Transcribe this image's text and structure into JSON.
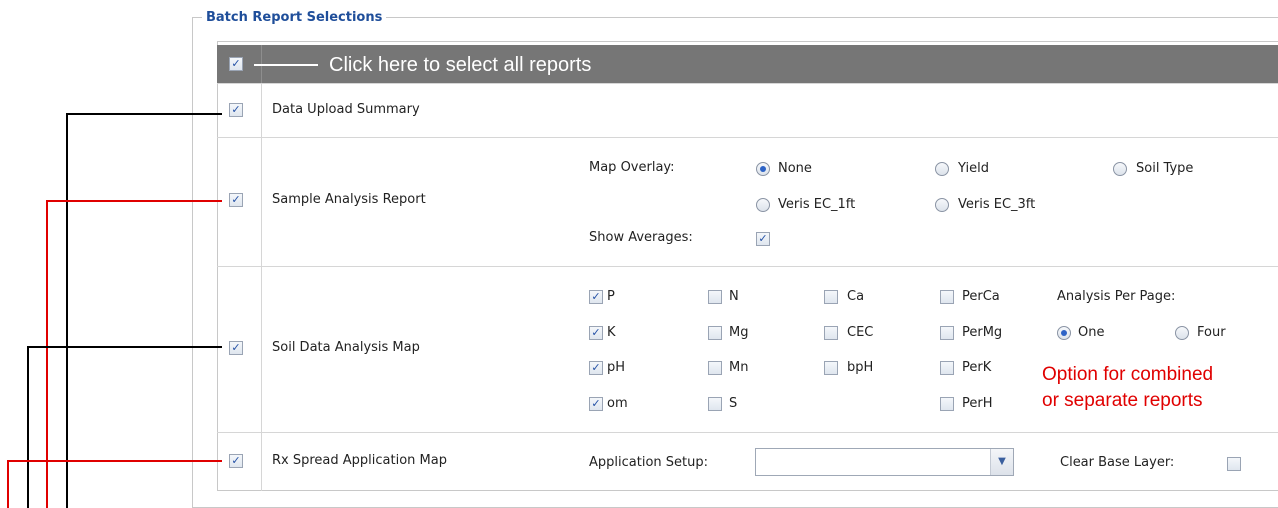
{
  "panel": {
    "title": "Batch Report Selections"
  },
  "header": {
    "select_all_label": "Click here to select all reports",
    "select_all_checked": true
  },
  "rows": {
    "upload": {
      "label": "Data Upload Summary",
      "checked": true
    },
    "sample": {
      "label": "Sample Analysis Report",
      "checked": true,
      "overlay_label": "Map Overlay:",
      "overlay_options": [
        "None",
        "Yield",
        "Soil Type",
        "Veris EC_1ft",
        "Veris EC_3ft"
      ],
      "overlay_selected": "None",
      "averages_label": "Show Averages:",
      "averages_checked": true
    },
    "soil": {
      "label": "Soil Data Analysis Map",
      "checked": true,
      "nutrients": [
        {
          "label": "P",
          "checked": true
        },
        {
          "label": "N",
          "checked": false
        },
        {
          "label": "Ca",
          "checked": false
        },
        {
          "label": "PerCa",
          "checked": false
        },
        {
          "label": "K",
          "checked": true
        },
        {
          "label": "Mg",
          "checked": false
        },
        {
          "label": "CEC",
          "checked": false
        },
        {
          "label": "PerMg",
          "checked": false
        },
        {
          "label": "pH",
          "checked": true
        },
        {
          "label": "Mn",
          "checked": false
        },
        {
          "label": "bpH",
          "checked": false
        },
        {
          "label": "PerK",
          "checked": false
        },
        {
          "label": "om",
          "checked": true
        },
        {
          "label": "S",
          "checked": false
        },
        {
          "label": "PerH",
          "checked": false
        }
      ],
      "per_page_label": "Analysis Per Page:",
      "per_page_options": [
        "One",
        "Four"
      ],
      "per_page_selected": "One"
    },
    "rx": {
      "label": "Rx Spread Application Map",
      "checked": true,
      "setup_label": "Application Setup:",
      "setup_value": "",
      "clear_label": "Clear Base Layer:",
      "clear_checked": false
    }
  },
  "annotation": {
    "line1": "Option for combined",
    "line2": "or separate reports"
  },
  "colors": {
    "accent": "#1f4e9a",
    "header_bg": "#767676",
    "annotation": "#e00000"
  },
  "icons": {
    "check": "✓",
    "dropdown": "chevron-down-icon"
  }
}
